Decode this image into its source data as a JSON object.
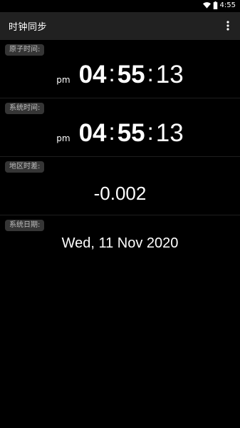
{
  "status_bar": {
    "time": "4:55",
    "wifi_icon": "wifi-icon",
    "battery_icon": "battery-icon"
  },
  "app_bar": {
    "title": "时钟同步",
    "overflow_icon": "more-vert-icon"
  },
  "atomic_time": {
    "label": "原子时间:",
    "ampm": "pm",
    "hours": "04",
    "minutes": "55",
    "seconds": "13",
    "separator": ":"
  },
  "system_time": {
    "label": "系统时间:",
    "ampm": "pm",
    "hours": "04",
    "minutes": "55",
    "seconds": "13",
    "separator": ":"
  },
  "time_offset": {
    "label": "地区时差:",
    "value": "-0.002"
  },
  "system_date": {
    "label": "系统日期:",
    "value": "Wed, 11 Nov 2020"
  }
}
